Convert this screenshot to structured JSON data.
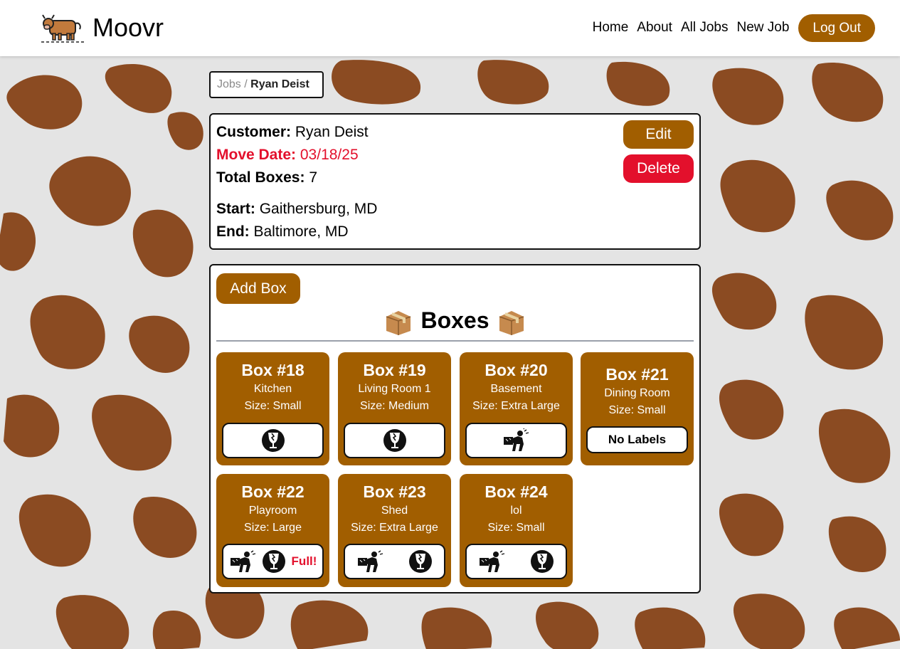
{
  "app": {
    "brand": "Moovr",
    "nav": [
      "Home",
      "About",
      "All Jobs",
      "New Job"
    ],
    "logout_label": "Log Out",
    "accent_color": "#a15e00",
    "danger_color": "#e3102c"
  },
  "breadcrumb": {
    "jobs_link": "Jobs",
    "separator": "/",
    "current": "Ryan Deist"
  },
  "job": {
    "customer_label": "Customer:",
    "customer": "Ryan Deist",
    "move_date_label": "Move Date:",
    "move_date": "03/18/25",
    "total_boxes_label": "Total Boxes:",
    "total_boxes": "7",
    "start_label": "Start:",
    "start": "Gaithersburg, MD",
    "end_label": "End:",
    "end": "Baltimore, MD",
    "edit_label": "Edit",
    "delete_label": "Delete"
  },
  "boxes_section": {
    "add_box_label": "Add Box",
    "title": "Boxes"
  },
  "boxes": [
    {
      "title": "Box #18",
      "room": "Kitchen",
      "size": "Size: Small",
      "labels": [
        "fragile-icon"
      ],
      "full_text": "",
      "no_labels_text": ""
    },
    {
      "title": "Box #19",
      "room": "Living Room 1",
      "size": "Size: Medium",
      "labels": [
        "fragile-icon"
      ],
      "full_text": "",
      "no_labels_text": ""
    },
    {
      "title": "Box #20",
      "room": "Basement",
      "size": "Size: Extra Large",
      "labels": [
        "heavy-lift-icon"
      ],
      "full_text": "",
      "no_labels_text": ""
    },
    {
      "title": "Box #21",
      "room": "Dining Room",
      "size": "Size: Small",
      "labels": [],
      "full_text": "",
      "no_labels_text": "No Labels"
    },
    {
      "title": "Box #22",
      "room": "Playroom",
      "size": "Size: Large",
      "labels": [
        "heavy-lift-icon",
        "fragile-icon"
      ],
      "full_text": "Full!",
      "no_labels_text": ""
    },
    {
      "title": "Box #23",
      "room": "Shed",
      "size": "Size: Extra Large",
      "labels": [
        "heavy-lift-icon",
        "fragile-icon"
      ],
      "full_text": "",
      "no_labels_text": ""
    },
    {
      "title": "Box #24",
      "room": "lol",
      "size": "Size: Small",
      "labels": [
        "heavy-lift-icon",
        "fragile-icon"
      ],
      "full_text": "",
      "no_labels_text": ""
    }
  ]
}
